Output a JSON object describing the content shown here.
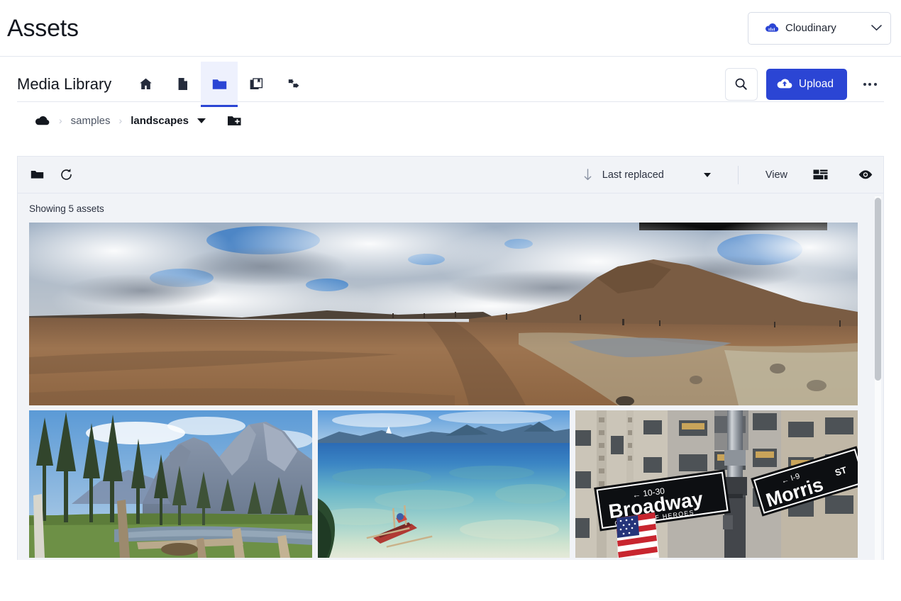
{
  "header": {
    "title": "Assets",
    "cloud_select": {
      "label": "Cloudinary",
      "icon": "cloudinary-logo-icon",
      "chevron": "chevron-down-icon"
    }
  },
  "media_library": {
    "title": "Media Library",
    "tabs": [
      {
        "id": "home",
        "icon": "home-icon",
        "label": "Home",
        "active": false
      },
      {
        "id": "assets",
        "icon": "document-icon",
        "label": "Assets",
        "active": false
      },
      {
        "id": "folders",
        "icon": "folder-icon",
        "label": "Folders",
        "active": true
      },
      {
        "id": "collections",
        "icon": "collection-icon",
        "label": "Collections",
        "active": false
      },
      {
        "id": "transformations",
        "icon": "transformations-icon",
        "label": "Transformations",
        "active": false
      }
    ],
    "search": {
      "icon": "search-icon",
      "label": "Search"
    },
    "upload": {
      "label": "Upload",
      "icon": "cloud-upload-icon",
      "color": "#2b45d4"
    },
    "more": {
      "icon": "kebab-menu-icon",
      "label": "More options"
    }
  },
  "breadcrumb": {
    "root_icon": "cloud-icon",
    "separator": "›",
    "items": [
      {
        "label": "samples",
        "current": false
      },
      {
        "label": "landscapes",
        "current": true
      }
    ],
    "dropdown_icon": "triangle-down-icon",
    "new_folder_icon": "new-folder-icon"
  },
  "panel": {
    "toolbar": {
      "folder_icon": "folder-filled-icon",
      "refresh_icon": "refresh-icon",
      "sort": {
        "direction_icon": "arrow-down-icon",
        "label": "Last replaced",
        "chevron_icon": "triangle-down-icon"
      },
      "view": {
        "label": "View",
        "grid_icon": "mosaic-view-icon",
        "preview_icon": "eye-icon"
      }
    },
    "status": "Showing 5 assets",
    "scrollbar": {
      "name": "vertical-scrollbar"
    },
    "assets": [
      {
        "id": "hero",
        "alt": "Panoramic volcanic desert landscape under dramatic storm clouds",
        "type": "image"
      },
      {
        "id": "thumb-1",
        "alt": "Yosemite valley with pine trees, granite cliffs and a river",
        "type": "image"
      },
      {
        "id": "thumb-2",
        "alt": "Tropical turquoise shallows with a red outrigger canoe",
        "type": "image"
      },
      {
        "id": "thumb-3",
        "alt": "New York street signs Broadway Canyon of Heroes and Morris St with US flag",
        "type": "image"
      }
    ]
  },
  "colors": {
    "accent": "#2b45d4",
    "panel_bg": "#f1f3f7",
    "border": "#e3e7ef",
    "text": "#13171f"
  }
}
